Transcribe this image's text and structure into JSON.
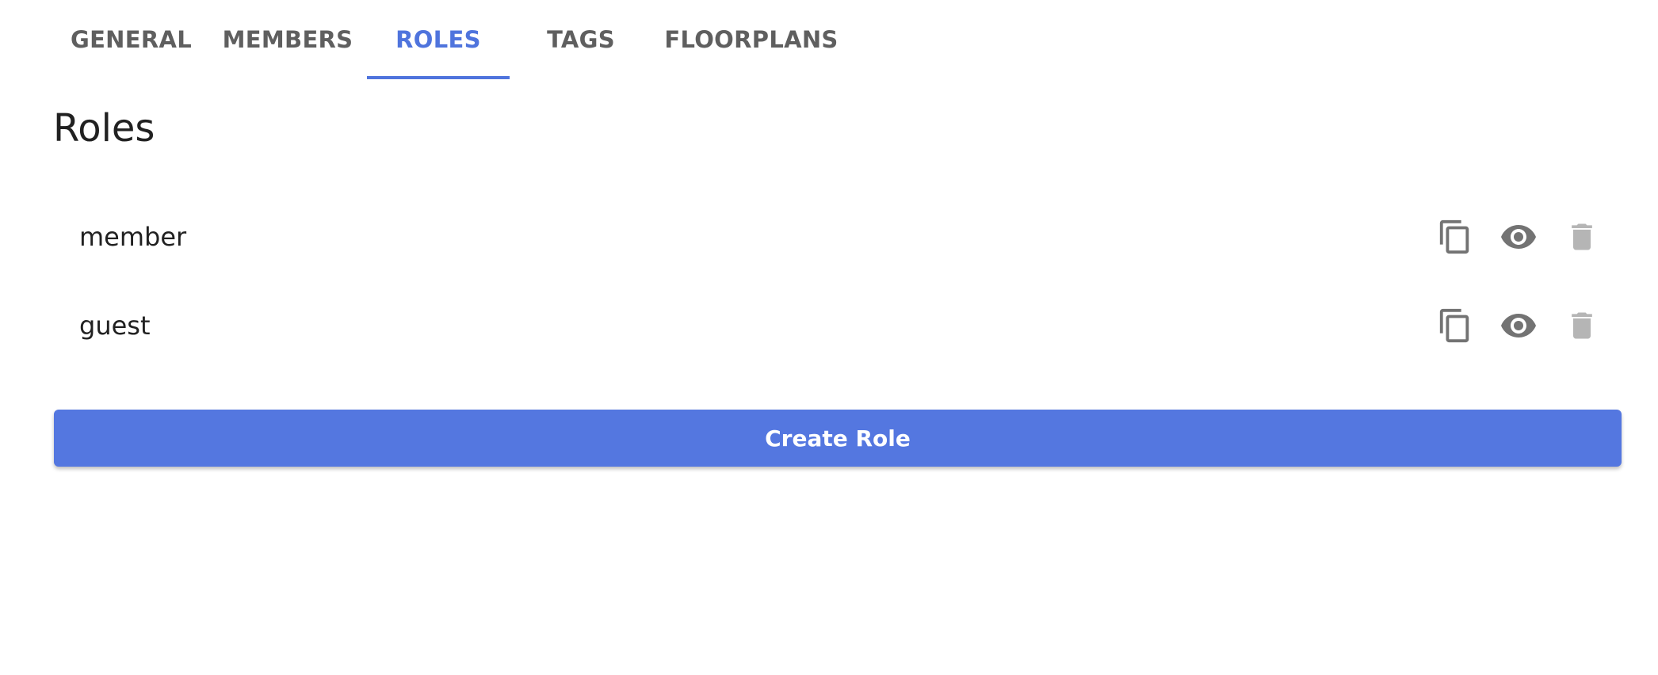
{
  "tabs": [
    {
      "label": "GENERAL",
      "active": false
    },
    {
      "label": "MEMBERS",
      "active": false
    },
    {
      "label": "ROLES",
      "active": true
    },
    {
      "label": "TAGS",
      "active": false
    },
    {
      "label": "FLOORPLANS",
      "active": false
    }
  ],
  "page": {
    "title": "Roles"
  },
  "roles": [
    {
      "name": "member",
      "actions": [
        "copy-icon",
        "eye-icon",
        "trash-icon"
      ]
    },
    {
      "name": "guest",
      "actions": [
        "copy-icon",
        "eye-icon",
        "trash-icon"
      ]
    }
  ],
  "create_button": {
    "label": "Create Role"
  },
  "colors": {
    "accent": "#4f74dd",
    "button": "#5477e0",
    "tab_text": "#5f5f5f",
    "icon_dark": "#737373",
    "icon_light": "#b5b5b5"
  }
}
